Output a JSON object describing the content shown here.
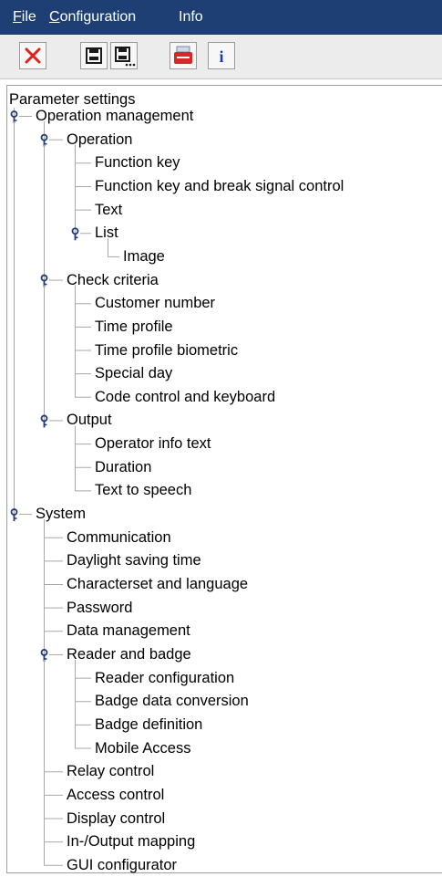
{
  "menu": {
    "file_first": "F",
    "file_rest": "ile",
    "config_first": "C",
    "config_rest": "onfiguration",
    "info": "Info"
  },
  "toolbar": {
    "buttons": [
      {
        "icon": "close-x-icon",
        "color": "#e0201a"
      },
      {
        "icon": "save-icon"
      },
      {
        "icon": "save-as-icon"
      },
      {
        "icon": "card-reader-icon",
        "color": "#d9262b"
      },
      {
        "icon": "info-icon",
        "color": "#1f3a9e"
      }
    ]
  },
  "tree": {
    "root": "Parameter settings",
    "highlight_color": "#ffff66",
    "items": [
      {
        "label": "Operation management",
        "level": 0,
        "expanded": true,
        "last": false
      },
      {
        "label": "Operation",
        "level": 1,
        "expanded": true,
        "last": false
      },
      {
        "label": "Function key",
        "level": 2,
        "last": false
      },
      {
        "label": "Function key and break signal control",
        "level": 2,
        "last": false
      },
      {
        "label": "Text",
        "level": 2,
        "last": false
      },
      {
        "label": "List",
        "level": 2,
        "expanded": true,
        "last": true
      },
      {
        "label": "Image",
        "level": 3,
        "last": true
      },
      {
        "label": "Check criteria",
        "level": 1,
        "expanded": true,
        "last": false
      },
      {
        "label": "Customer number",
        "level": 2,
        "last": false
      },
      {
        "label": "Time profile",
        "level": 2,
        "last": false
      },
      {
        "label": "Time profile biometric",
        "level": 2,
        "last": false
      },
      {
        "label": "Special day",
        "level": 2,
        "last": false
      },
      {
        "label": "Code control and keyboard",
        "level": 2,
        "last": true
      },
      {
        "label": "Output",
        "level": 1,
        "expanded": true,
        "last": true
      },
      {
        "label": "Operator info text",
        "level": 2,
        "last": false
      },
      {
        "label": "Duration",
        "level": 2,
        "last": false
      },
      {
        "label": "Text to speech",
        "level": 2,
        "last": true
      },
      {
        "label": "System",
        "level": 0,
        "expanded": true,
        "last": true
      },
      {
        "label": "Communication",
        "level": 1,
        "last": false
      },
      {
        "label": "Daylight saving time",
        "level": 1,
        "last": false
      },
      {
        "label": "Characterset and language",
        "level": 1,
        "last": false
      },
      {
        "label": "Password",
        "level": 1,
        "last": false
      },
      {
        "label": "Data management",
        "level": 1,
        "last": false
      },
      {
        "label": "Reader and badge",
        "level": 1,
        "expanded": true,
        "last": false
      },
      {
        "label": "Reader configuration",
        "level": 2,
        "last": false
      },
      {
        "label": "Badge data conversion",
        "level": 2,
        "last": false
      },
      {
        "label": "Badge definition",
        "level": 2,
        "last": false
      },
      {
        "label": "Mobile Access",
        "level": 2,
        "last": true
      },
      {
        "label": "Relay control",
        "level": 1,
        "last": false
      },
      {
        "label": "Access control",
        "level": 1,
        "last": false
      },
      {
        "label": "Display control",
        "level": 1,
        "last": false
      },
      {
        "label": "In-/Output mapping",
        "level": 1,
        "last": false
      },
      {
        "label": "GUI configurator",
        "level": 1,
        "last": true,
        "highlighted": true
      }
    ]
  }
}
